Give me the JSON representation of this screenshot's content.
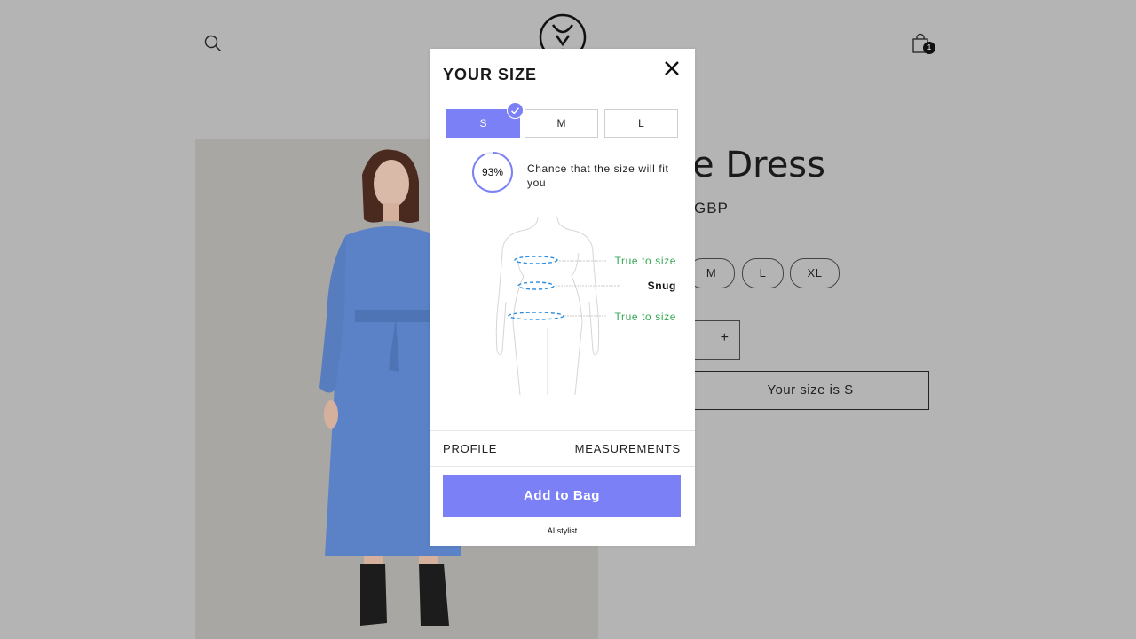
{
  "header": {
    "search_icon": "search-icon",
    "logo_icon": "brand-logo",
    "cart_icon": "shopping-bag-icon",
    "cart_count": "1"
  },
  "product": {
    "title_visible": "e Dress",
    "price_visible": "GBP",
    "sizes_visible": [
      "M",
      "L",
      "XL"
    ],
    "quantity_plus": "+",
    "your_size_button": "Your size is S"
  },
  "modal": {
    "title": "YOUR SIZE",
    "close_icon": "close-icon",
    "size_tabs": [
      "S",
      "M",
      "L"
    ],
    "selected_size": "S",
    "fit_chance": {
      "percent_label": "93%",
      "value": 0.93,
      "text": "Chance that the size will fit you"
    },
    "fit_indicators": [
      {
        "label": "True to size",
        "status": "good"
      },
      {
        "label": "Snug",
        "status": "tight"
      },
      {
        "label": "True to size",
        "status": "good"
      }
    ],
    "nav": {
      "profile": "PROFILE",
      "measurements": "MEASUREMENTS"
    },
    "add_to_bag": "Add to Bag",
    "footer": "AI stylist"
  },
  "colors": {
    "accent": "#7b80f7",
    "good": "#35a853",
    "overlay_bg": "#b4b4b4"
  }
}
